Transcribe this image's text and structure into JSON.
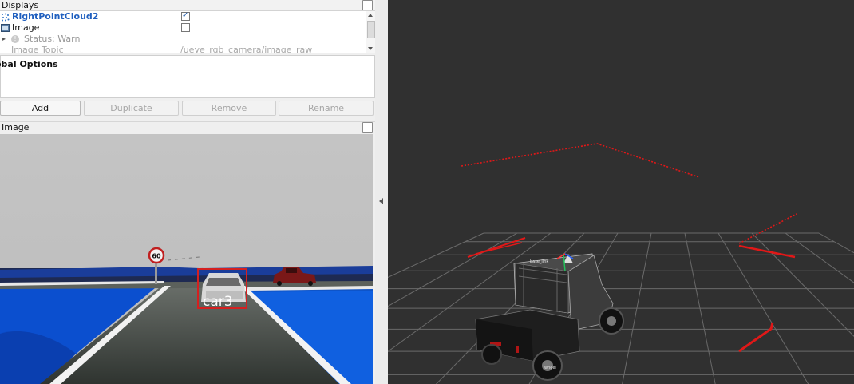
{
  "displays_panel": {
    "title": "Displays",
    "rows": [
      {
        "label": "RightPointCloud2",
        "checked": true
      },
      {
        "label": "Image",
        "checked": false
      },
      {
        "label": "Status: Warn"
      },
      {
        "label": "Image Topic",
        "value": "/ueye_rgb_camera/image_raw"
      }
    ]
  },
  "description": {
    "title": "obal Options"
  },
  "buttons": {
    "add": "Add",
    "duplicate": "Duplicate",
    "remove": "Remove",
    "rename": "Rename"
  },
  "image_panel": {
    "title": "Image",
    "speed_sign": "60",
    "detection_label": "car3",
    "detection_color": "#d42020"
  },
  "viewport": {
    "background": "#303030",
    "grid_color": "#6a6a6a",
    "points_color": "#e01818",
    "frame_label_base": "base_link",
    "frame_label_wheel": "wheel"
  }
}
